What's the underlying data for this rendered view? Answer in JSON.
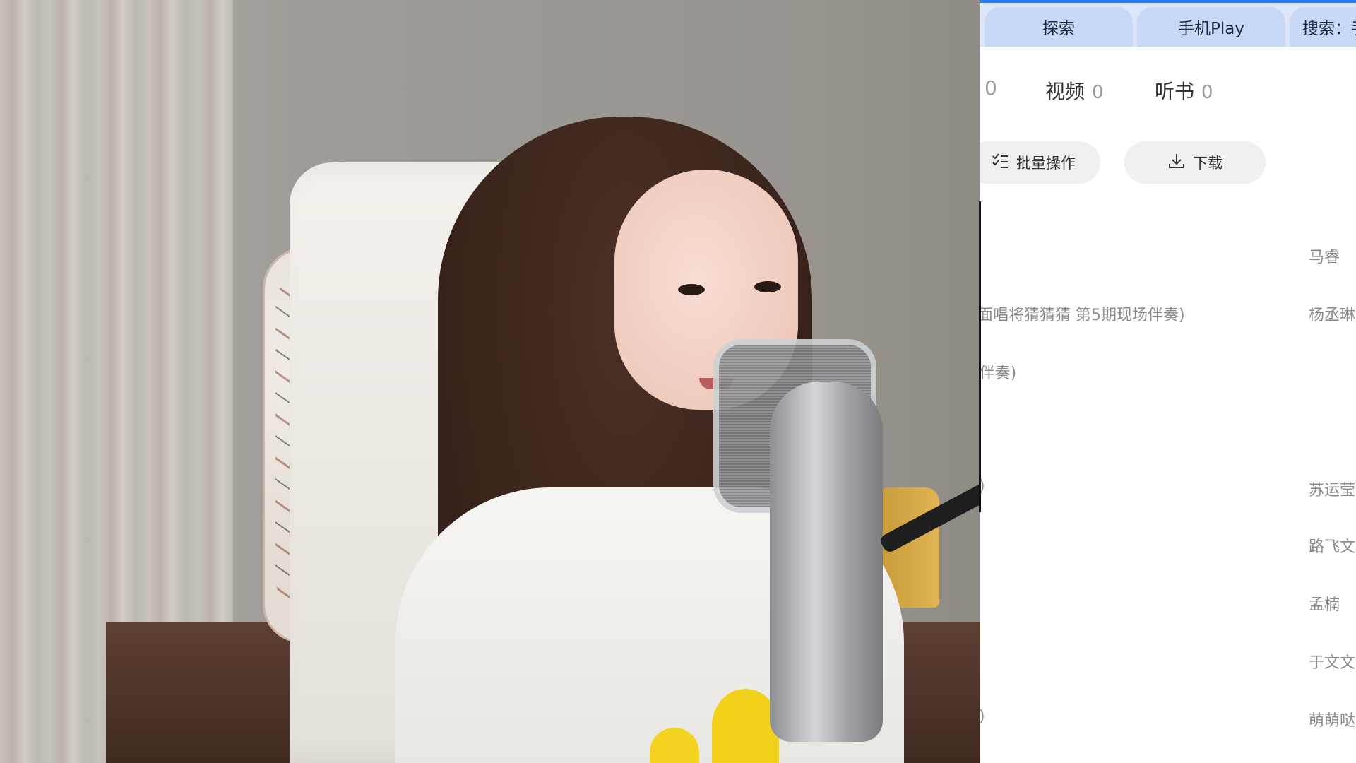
{
  "tabs": [
    "探索",
    "手机Play",
    "搜索：手"
  ],
  "counts": {
    "first_num": "0",
    "video_label": "视频",
    "video_num": "0",
    "audiobook_label": "听书",
    "audiobook_num": "0"
  },
  "actions": {
    "batch_label": "批量操作",
    "download_label": "下载"
  },
  "rows": [
    {
      "title": "",
      "artist": "马睿"
    },
    {
      "title": "面唱将猜猜猜 第5期现场伴奏)",
      "artist": "杨丞琳"
    },
    {
      "title": "(伴奏)",
      "artist": ""
    },
    {
      "title": "",
      "artist": ""
    },
    {
      "title": ")",
      "artist": "苏运莹"
    },
    {
      "title": "",
      "artist": "路飞文"
    },
    {
      "title": "",
      "artist": "孟楠"
    },
    {
      "title": "",
      "artist": "于文文"
    },
    {
      "title": ")",
      "artist": "萌萌哒"
    }
  ],
  "colors": {
    "tab_bar": "#dbe6fb",
    "tab": "#c8d9f7",
    "accent": "#2f7bf0",
    "pill": "#f0f0f0"
  }
}
